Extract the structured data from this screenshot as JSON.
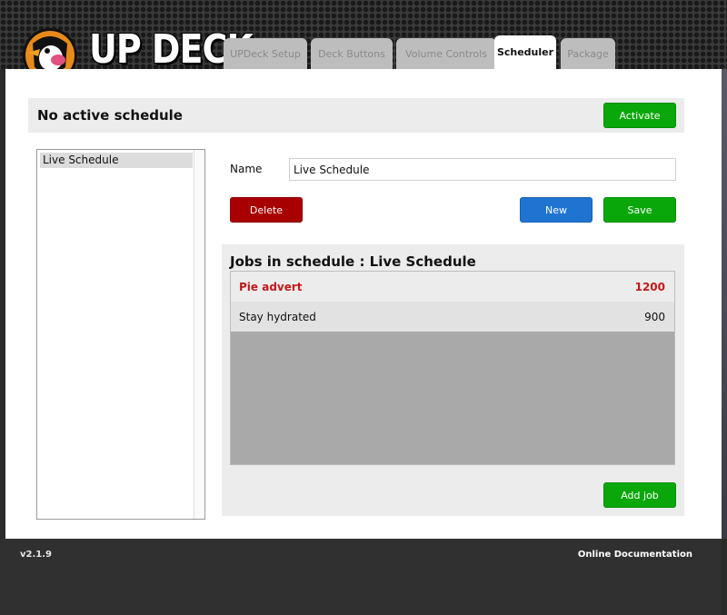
{
  "app": {
    "logo_text": "UP DECK"
  },
  "tabs": [
    {
      "label": "UPDeck Setup"
    },
    {
      "label": "Deck Buttons"
    },
    {
      "label": "Volume Controls"
    },
    {
      "label": "Scheduler"
    },
    {
      "label": "Package"
    }
  ],
  "active_tab": "Scheduler",
  "status": {
    "text": "No active schedule",
    "activate_label": "Activate"
  },
  "schedules": [
    {
      "name": "Live Schedule"
    }
  ],
  "form": {
    "name_label": "Name",
    "name_value": "Live Schedule",
    "delete_label": "Delete",
    "new_label": "New",
    "save_label": "Save"
  },
  "jobs": {
    "title": "Jobs in schedule : Live Schedule",
    "rows": [
      {
        "name": "Pie advert",
        "value": "1200"
      },
      {
        "name": "Stay hydrated",
        "value": "900"
      }
    ],
    "add_label": "Add job"
  },
  "footer": {
    "version": "v2.1.9",
    "docs_label": "Online Documentation"
  },
  "colors": {
    "green": "#0aa70a",
    "red": "#a80000",
    "blue": "#1e74d0",
    "selected_text": "#c01a1a"
  }
}
